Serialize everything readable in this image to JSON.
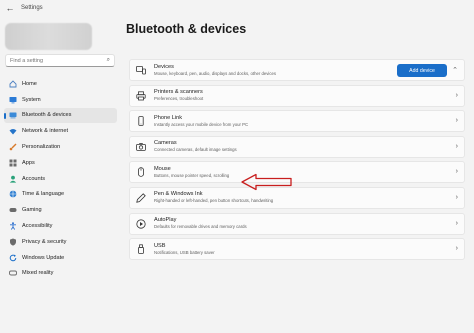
{
  "window": {
    "title": "Settings"
  },
  "search": {
    "placeholder": "Find a setting"
  },
  "sidebar": {
    "items": [
      {
        "label": "Home",
        "icon": "home-icon",
        "color": "#4a7fc1"
      },
      {
        "label": "System",
        "icon": "system-icon",
        "color": "#2b7bd6"
      },
      {
        "label": "Bluetooth & devices",
        "icon": "bluetooth-icon",
        "color": "#3a8ad8"
      },
      {
        "label": "Network & internet",
        "icon": "wifi-icon",
        "color": "#2574c9"
      },
      {
        "label": "Personalization",
        "icon": "brush-icon",
        "color": "#d87b2c"
      },
      {
        "label": "Apps",
        "icon": "apps-icon",
        "color": "#6b6b6b"
      },
      {
        "label": "Accounts",
        "icon": "accounts-icon",
        "color": "#2aa27a"
      },
      {
        "label": "Time & language",
        "icon": "globe-icon",
        "color": "#2f7fd1"
      },
      {
        "label": "Gaming",
        "icon": "gaming-icon",
        "color": "#6b6b6b"
      },
      {
        "label": "Accessibility",
        "icon": "accessibility-icon",
        "color": "#2b6fcf"
      },
      {
        "label": "Privacy & security",
        "icon": "shield-icon",
        "color": "#6b6b6b"
      },
      {
        "label": "Windows Update",
        "icon": "update-icon",
        "color": "#1a6ec9"
      },
      {
        "label": "Mixed reality",
        "icon": "mixed-reality-icon",
        "color": "#6b6b6b"
      }
    ],
    "active": "Bluetooth & devices"
  },
  "main": {
    "title": "Bluetooth & devices",
    "add_device": "Add device",
    "cards": [
      {
        "title": "Devices",
        "sub": "Mouse, keyboard, pen, audio, displays and docks, other devices",
        "icon": "devices-icon"
      },
      {
        "title": "Printers & scanners",
        "sub": "Preferences, troubleshoot",
        "icon": "printer-icon"
      },
      {
        "title": "Phone Link",
        "sub": "Instantly access your mobile device from your PC",
        "icon": "phone-icon"
      },
      {
        "title": "Cameras",
        "sub": "Connected cameras, default image settings",
        "icon": "camera-icon"
      },
      {
        "title": "Mouse",
        "sub": "Buttons, mouse pointer speed, scrolling",
        "icon": "mouse-icon"
      },
      {
        "title": "Pen & Windows Ink",
        "sub": "Right-handed or left-handed, pen button shortcuts, handwriting",
        "icon": "pen-icon"
      },
      {
        "title": "AutoPlay",
        "sub": "Defaults for removable drives and memory cards",
        "icon": "autoplay-icon"
      },
      {
        "title": "USB",
        "sub": "Notifications, USB battery saver",
        "icon": "usb-icon"
      }
    ]
  },
  "annotation": {
    "icon": "arrow-left-icon",
    "color": "#c81e1e"
  },
  "colors": {
    "accent": "#1a6ec9"
  }
}
